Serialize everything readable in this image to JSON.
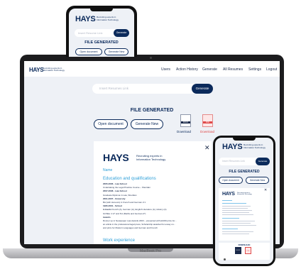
{
  "brand": {
    "logo": "HAYS",
    "tagline": "Recruiting experts in Information Technology"
  },
  "laptop": {
    "model": "MacBook Pro",
    "nav": [
      "Users",
      "Action History",
      "Generate",
      "All Resumes",
      "Settings",
      "Logout"
    ],
    "search_placeholder": "Insert Resumes Link",
    "generate_label": "Generate",
    "file_generated": "FILE GENERATED",
    "open_document": "Open document",
    "generate_new": "Generate New",
    "docx_badge": "DOCX",
    "pdf_badge": "PDF",
    "download_label": "Download",
    "close_glyph": "✕",
    "resume": {
      "name": "Name",
      "education_title": "Education and qualifications",
      "lines": [
        {
          "bold": "2005-2006 - Law School",
          "text": ""
        },
        {
          "bold": "",
          "text": "Undertaking the Legal Practice Course – Sheridan"
        },
        {
          "bold": "2007-2008 - Law School",
          "text": ""
        },
        {
          "bold": "",
          "text": "Graduate Diploma in Law, Sheridan"
        },
        {
          "bold": "2001-2007 - University",
          "text": ""
        },
        {
          "bold": "",
          "text": "BA (with Honours) in French and German 2:1"
        },
        {
          "bold": "1995-2001 - School",
          "text": ""
        },
        {
          "bold": "A-levels",
          "text": " French (A), German (A), English Literature (A), History (A)"
        },
        {
          "bold": "",
          "text": "GCSEs: 2 A* and 8 A (Maths and German A*)"
        },
        {
          "bold": "Awards",
          "text": ""
        },
        {
          "bold": "",
          "text": "Runner up in Newspaper Law Awards 2003 – presented with £1000 prize for... "
        },
        {
          "bold": "",
          "text": "an article in the professional legal press, Scholarship awarded for essay on..."
        },
        {
          "bold": "",
          "text": "and prize for Modern Languages and German and French"
        }
      ],
      "work_title": "Work experience"
    }
  },
  "phone_top": {
    "search_placeholder": "Insert Resume Link",
    "generate_label": "Generate",
    "file_generated": "FILE GENERATED",
    "open_document": "Open document",
    "generate_new": "Generate New"
  },
  "phone_right": {
    "search_placeholder": "Insert Resumes Link",
    "generate_label": "Generate",
    "file_generated": "FILE GENERATED",
    "open_document": "Open document",
    "generate_new": "Generate New",
    "close_glyph": "✕",
    "download_title": "DOWNLOAD",
    "docx_badge": "DOCX",
    "pdf_badge": "PDF"
  }
}
